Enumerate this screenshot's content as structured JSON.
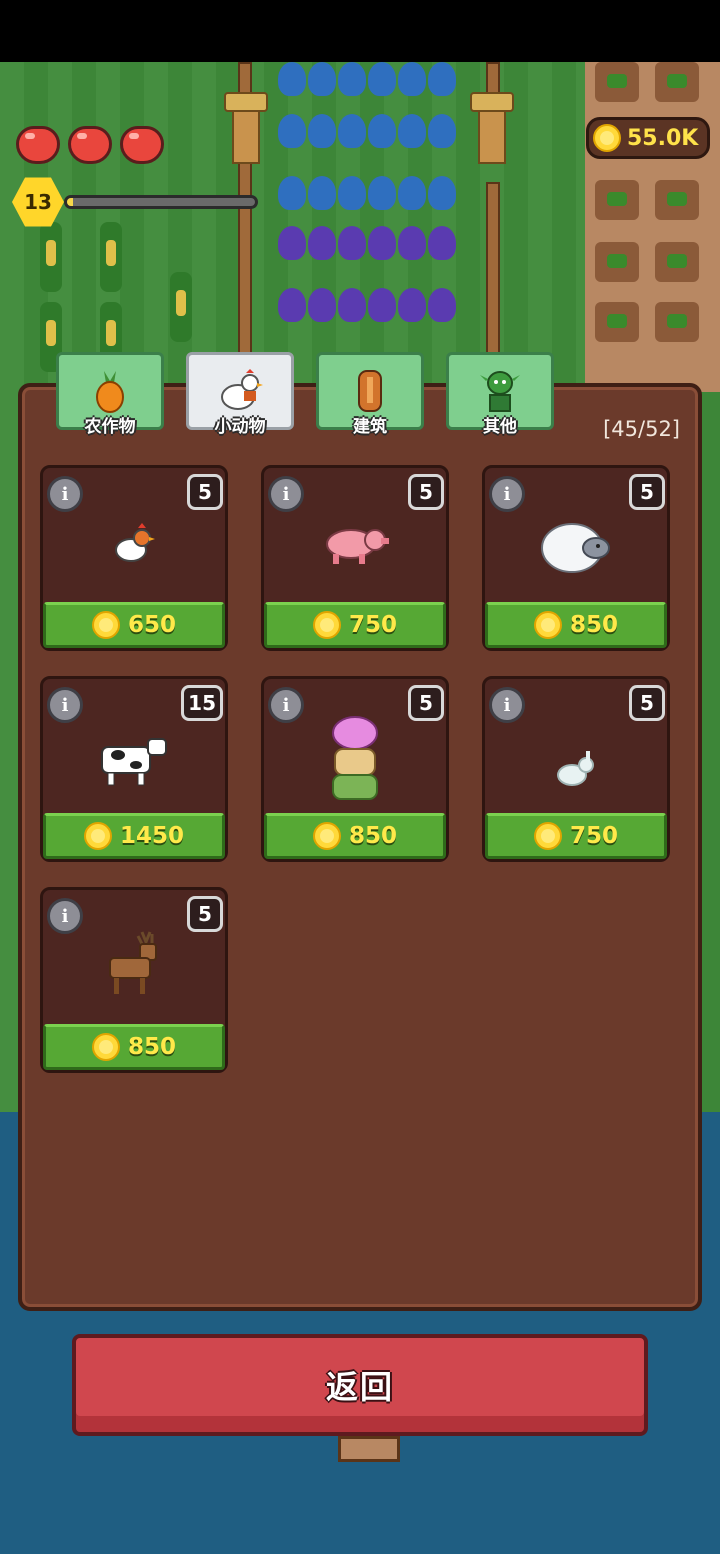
{
  "hud": {
    "level": "13",
    "xp_progress": 0.03,
    "coins": "55.0K",
    "hearts": 3
  },
  "tabs": [
    {
      "label": "农作物",
      "icon": "carrot-icon",
      "active": false
    },
    {
      "label": "小动物",
      "icon": "chicken-icon",
      "active": true
    },
    {
      "label": "建筑",
      "icon": "building-icon",
      "active": false
    },
    {
      "label": "其他",
      "icon": "goblin-icon",
      "active": false
    }
  ],
  "panel": {
    "count": "[45/52]"
  },
  "items": [
    {
      "animal": "chicken",
      "icon": "chicken-icon",
      "stock": "5",
      "price": "650"
    },
    {
      "animal": "pig",
      "icon": "pig-icon",
      "stock": "5",
      "price": "750"
    },
    {
      "animal": "sheep",
      "icon": "sheep-icon",
      "stock": "5",
      "price": "850"
    },
    {
      "animal": "cow",
      "icon": "cow-icon",
      "stock": "15",
      "price": "1450"
    },
    {
      "animal": "slime-stack",
      "icon": "slime-stack-icon",
      "stock": "5",
      "price": "850"
    },
    {
      "animal": "rabbit",
      "icon": "rabbit-icon",
      "stock": "5",
      "price": "750"
    },
    {
      "animal": "deer",
      "icon": "deer-icon",
      "stock": "5",
      "price": "850"
    }
  ],
  "info_glyph": "i",
  "back_button": "返回",
  "colors": {
    "panel": "#6b3a2b",
    "card": "#4d2621",
    "price_button": "#56a834",
    "price_text": "#ffe94a",
    "back_button": "#d0474e",
    "tab": "#7fcf8e",
    "tab_active": "#e9ecef"
  }
}
